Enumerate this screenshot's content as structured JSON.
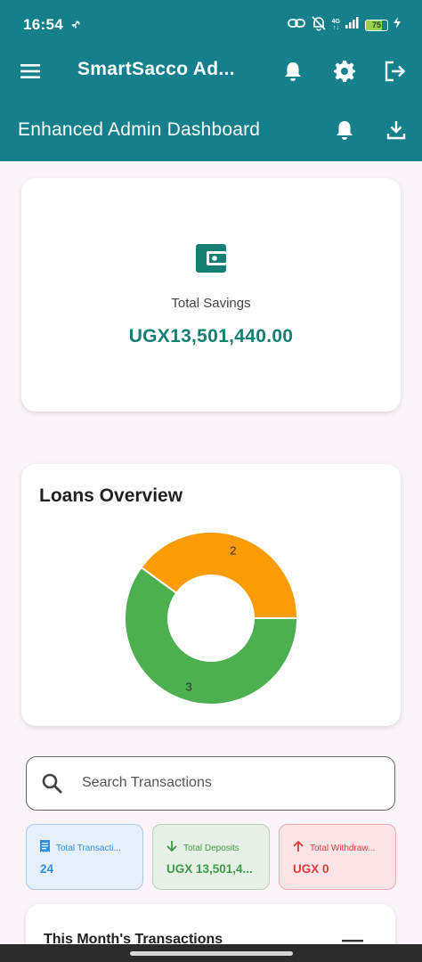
{
  "status_bar": {
    "time": "16:54",
    "network": "4G",
    "battery": "75",
    "battery_level": 0.75
  },
  "app_bar": {
    "title": "SmartSacco Ad...",
    "icons": [
      "menu-icon",
      "bell-icon",
      "gear-icon",
      "logout-icon"
    ]
  },
  "sub_bar": {
    "subtitle": "Enhanced Admin Dashboard",
    "icons": [
      "bell-icon",
      "download-icon"
    ]
  },
  "savings": {
    "label": "Total Savings",
    "amount": "UGX13,501,440.00",
    "icon": "wallet-icon"
  },
  "loans": {
    "heading": "Loans Overview"
  },
  "chart_data": {
    "type": "pie",
    "donut": true,
    "categories": [
      "",
      ""
    ],
    "values": [
      2,
      3
    ],
    "slice_labels": [
      "2",
      "3"
    ],
    "colors": [
      "#fb9b05",
      "#4caf50"
    ]
  },
  "search": {
    "placeholder": "Search Transactions"
  },
  "stats": {
    "total": {
      "label": "Total Transacti...",
      "value": "24",
      "icon": "receipt-icon"
    },
    "deposits": {
      "label": "Total Deposits",
      "value": "UGX 13,501,4...",
      "icon": "arrow-down-icon"
    },
    "withdrawals": {
      "label": "Total Withdraw...",
      "value": "UGX 0",
      "icon": "arrow-up-icon"
    }
  },
  "month": {
    "heading": "This Month's Transactions"
  },
  "colors": {
    "primary": "#157f8c",
    "accent_text": "#157f74",
    "background": "#fbf5fb"
  }
}
